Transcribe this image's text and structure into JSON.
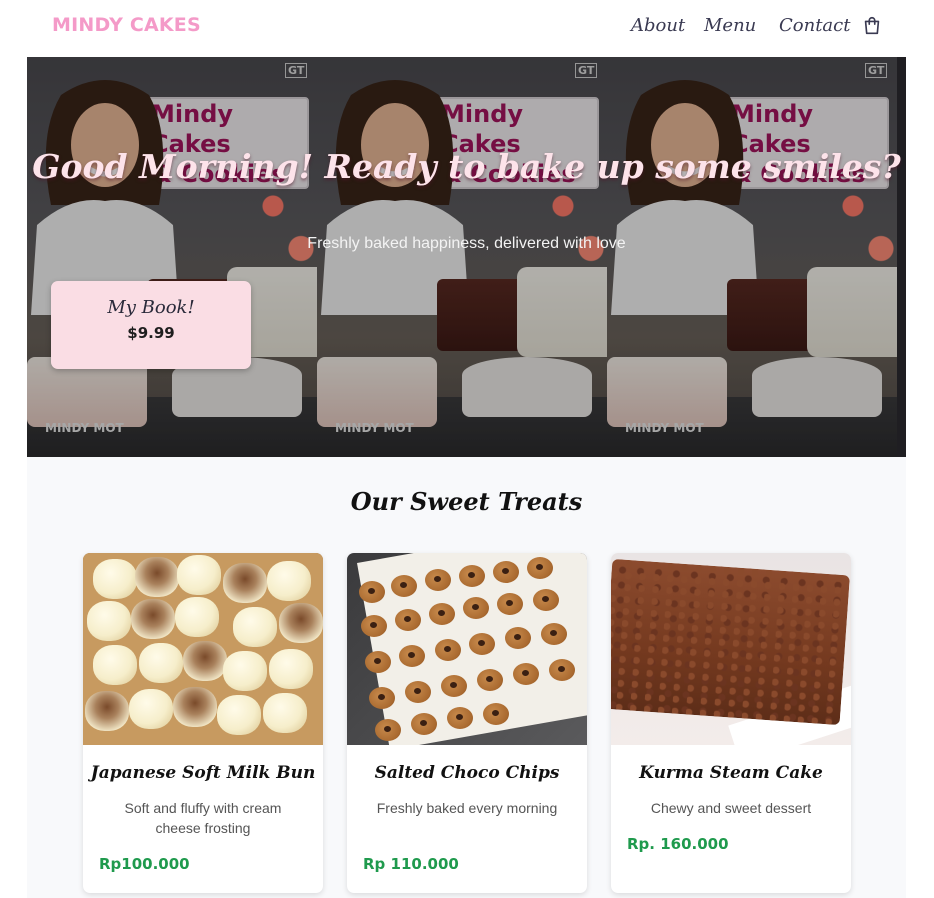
{
  "nav": {
    "brand": "MINDY CAKES",
    "links": [
      "About",
      "Menu",
      "Contact"
    ],
    "cart_icon": "shopping-bag-icon"
  },
  "hero": {
    "title": "Good Morning! Ready to bake up some smiles?",
    "subtitle": "Freshly baked happiness, delivered with love",
    "banner_sign_line1": "Mindy Cakes",
    "banner_sign_line2": "& Cookies",
    "banner_caption": "MINDY MOT",
    "banner_logo": "GT",
    "book": {
      "title": "My Book!",
      "price": "$9.99"
    }
  },
  "treats": {
    "heading": "Our Sweet Treats",
    "items": [
      {
        "name": "Japanese Soft Milk Bun",
        "description": "Soft and fluffy with cream cheese frosting",
        "price": "Rp100.000"
      },
      {
        "name": "Salted Choco Chips",
        "description": "Freshly baked every morning",
        "price": "Rp 110.000"
      },
      {
        "name": "Kurma Steam Cake",
        "description": "Chewy and sweet dessert",
        "price": "Rp. 160.000"
      }
    ]
  },
  "colors": {
    "brand_pink": "#f49ac8",
    "price_green": "#1f9a4d",
    "book_card_bg": "#fadde4",
    "section_bg": "#f8f9fb"
  }
}
